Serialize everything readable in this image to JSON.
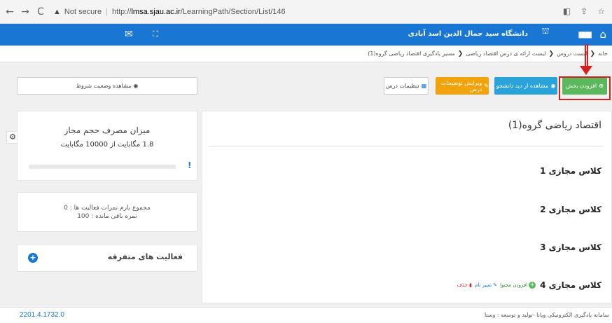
{
  "browser": {
    "back": "←",
    "forward": "→",
    "reload": "C",
    "security_icon": "▲",
    "security_label": "Not secure",
    "url_prefix": "http://",
    "url_host": "lmsa.sjau.ac.ir",
    "url_path": "/LearningPath/Section/List/146",
    "translate_icon": "◧",
    "share_icon": "⇪",
    "star_icon": "☆"
  },
  "header": {
    "university_name": "دانشگاه سید جمال الدین اسد آبادی",
    "home_icon": "⌂",
    "grid_icon": "■■",
    "logo_icon": "⛫",
    "mail_icon": "✉",
    "fullscreen_icon": "⛶"
  },
  "breadcrumb": {
    "items": [
      "خانه",
      "لیست دروس",
      "لیست ارائه ی درس اقتصاد ریاضی",
      "مسیر یادگیری اقتصاد ریاضی گروه(1)"
    ],
    "separator": "❮"
  },
  "toolbar": {
    "add_section": "افزودن بخش",
    "student_view": "مشاهده از دید دانشجو",
    "edit_description": "ویرایش توضیحات درس",
    "course_settings": "تنظیمات درس",
    "view_conditions": "مشاهده وضعیت شروط"
  },
  "usage": {
    "title": "میزان مصرف حجم مجاز",
    "amount": "1.8 مگابایت از 10000 مگابایت",
    "fraction": 0.0002,
    "warn_icon": "!"
  },
  "scores": {
    "line1": "مجموع بارم نمرات فعالیت ها : 0",
    "line2": "نمره باقی مانده : 100"
  },
  "misc": {
    "title": "فعالیت های متفرقه",
    "add_icon": "+"
  },
  "course": {
    "title": "اقتصاد ریاضی گروه(1)",
    "sections": [
      {
        "label": "کلاس مجازی 1"
      },
      {
        "label": "کلاس مجازی 2"
      },
      {
        "label": "کلاس مجازی 3"
      },
      {
        "label": "کلاس مجازی 4"
      }
    ],
    "actions": {
      "add_content": "افزودن محتوا",
      "rename": "تغییر نام",
      "delete": "حذف"
    }
  },
  "footer": {
    "version": "2201.4.1732.0",
    "credit": "سامانه یادگیری الکترونیکی ویانا -تولید و توسعه : وستا"
  },
  "colors": {
    "primary": "#1976d2",
    "success": "#5cb85c",
    "info": "#29a3d9",
    "warning": "#f0a30a",
    "highlight": "#d62020"
  }
}
